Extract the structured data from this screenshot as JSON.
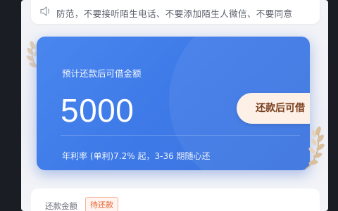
{
  "notice": {
    "text": "防范，不要接听陌生电话、不要添加陌生人微信、不要同意",
    "icon": "speaker-icon"
  },
  "card": {
    "title": "预计还款后可借金额",
    "amount": "5000",
    "button_label": "还款后可借",
    "rate_text": "年利率 (单利)7.2% 起，3-36 期随心还",
    "color_start": "#4a86ee",
    "color_end": "#3a73e0",
    "button_bg": "#fdf1e7",
    "button_text_color": "#7a3f1e"
  },
  "repayment": {
    "label": "还款金额",
    "status_badge": "待还款",
    "badge_color": "#e6612e"
  }
}
